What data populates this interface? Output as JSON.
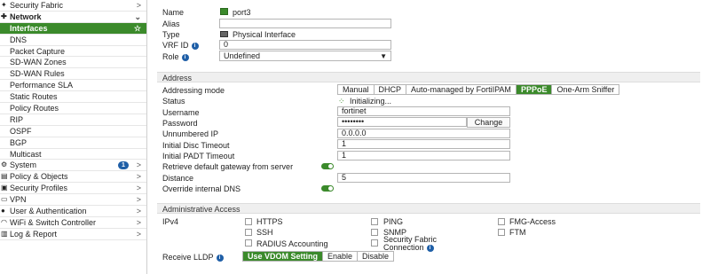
{
  "sidebar": {
    "items": [
      {
        "label": "Security Fabric",
        "chevron": ">"
      },
      {
        "label": "Network",
        "chevron": "⌄"
      },
      {
        "label": "Interfaces",
        "star": "☆"
      },
      {
        "label": "DNS"
      },
      {
        "label": "Packet Capture"
      },
      {
        "label": "SD-WAN Zones"
      },
      {
        "label": "SD-WAN Rules"
      },
      {
        "label": "Performance SLA"
      },
      {
        "label": "Static Routes"
      },
      {
        "label": "Policy Routes"
      },
      {
        "label": "RIP"
      },
      {
        "label": "OSPF"
      },
      {
        "label": "BGP"
      },
      {
        "label": "Multicast"
      },
      {
        "label": "System",
        "badge": "1",
        "chevron": ">"
      },
      {
        "label": "Policy & Objects",
        "chevron": ">"
      },
      {
        "label": "Security Profiles",
        "chevron": ">"
      },
      {
        "label": "VPN",
        "chevron": ">"
      },
      {
        "label": "User & Authentication",
        "chevron": ">"
      },
      {
        "label": "WiFi & Switch Controller",
        "chevron": ">"
      },
      {
        "label": "Log & Report",
        "chevron": ">"
      }
    ]
  },
  "form": {
    "name_label": "Name",
    "name_value": "port3",
    "alias_label": "Alias",
    "alias_value": "",
    "type_label": "Type",
    "type_value": "Physical Interface",
    "vrf_label": "VRF ID",
    "vrf_value": "0",
    "role_label": "Role",
    "role_value": "Undefined"
  },
  "address": {
    "section_title": "Address",
    "mode_label": "Addressing mode",
    "modes": [
      "Manual",
      "DHCP",
      "Auto-managed by FortiIPAM",
      "PPPoE",
      "One-Arm Sniffer"
    ],
    "mode_selected": "PPPoE",
    "status_label": "Status",
    "status_value": "Initializing...",
    "username_label": "Username",
    "username_value": "fortinet",
    "password_label": "Password",
    "password_value": "••••••••",
    "change_button": "Change",
    "unnumbered_label": "Unnumbered IP",
    "unnumbered_value": "0.0.0.0",
    "disc_label": "Initial Disc Timeout",
    "disc_value": "1",
    "padt_label": "Initial PADT Timeout",
    "padt_value": "1",
    "retrieve_gw_label": "Retrieve default gateway from server",
    "retrieve_gw_on": true,
    "distance_label": "Distance",
    "distance_value": "5",
    "override_dns_label": "Override internal DNS",
    "override_dns_on": true
  },
  "admin": {
    "section_title": "Administrative Access",
    "ipv4_label": "IPv4",
    "options": [
      "HTTPS",
      "PING",
      "FMG-Access",
      "SSH",
      "SNMP",
      "FTM",
      "RADIUS Accounting",
      "Security Fabric",
      "Connection"
    ],
    "lldp_label": "Receive LLDP",
    "lldp_options": [
      "Use VDOM Setting",
      "Enable",
      "Disable"
    ],
    "lldp_selected": "Use VDOM Setting"
  },
  "colors": {
    "accent": "#3b8a2b",
    "info": "#1f5fa7"
  }
}
